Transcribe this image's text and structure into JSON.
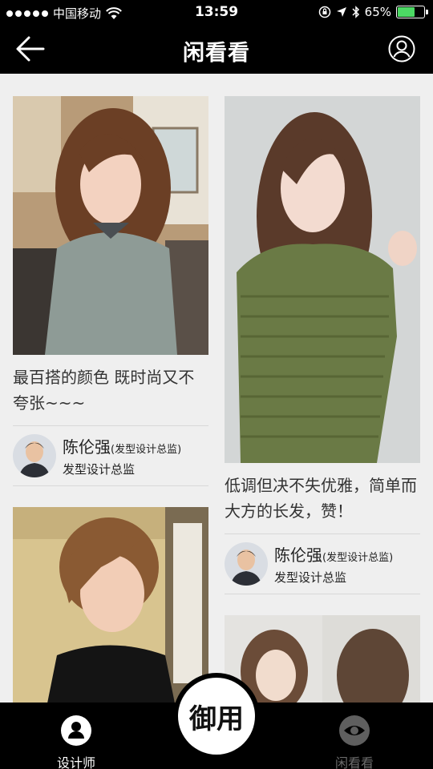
{
  "status_bar": {
    "carrier": "中国移动",
    "time": "13:59",
    "battery": "65%",
    "battery_level": 0.65
  },
  "nav": {
    "title": "闲看看",
    "back_icon": "back-arrow-icon",
    "profile_icon": "user-circle-icon"
  },
  "feed": {
    "cards": [
      {
        "caption": "最百搭的颜色 既时尚又不夸张~~~",
        "author_name": "陈伦强",
        "author_tag": "(发型设计总监)",
        "author_role": "发型设计总监"
      },
      {
        "caption": "低调但决不失优雅，简单而大方的长发，赞！",
        "author_name": "陈伦强",
        "author_tag": "(发型设计总监)",
        "author_role": "发型设计总监"
      },
      {
        "caption": ""
      },
      {
        "caption": ""
      }
    ]
  },
  "tabs": {
    "designer": {
      "label": "设计师",
      "icon": "person-icon"
    },
    "center": {
      "label": "御用"
    },
    "browse": {
      "label": "闲看看",
      "icon": "eye-icon"
    }
  }
}
